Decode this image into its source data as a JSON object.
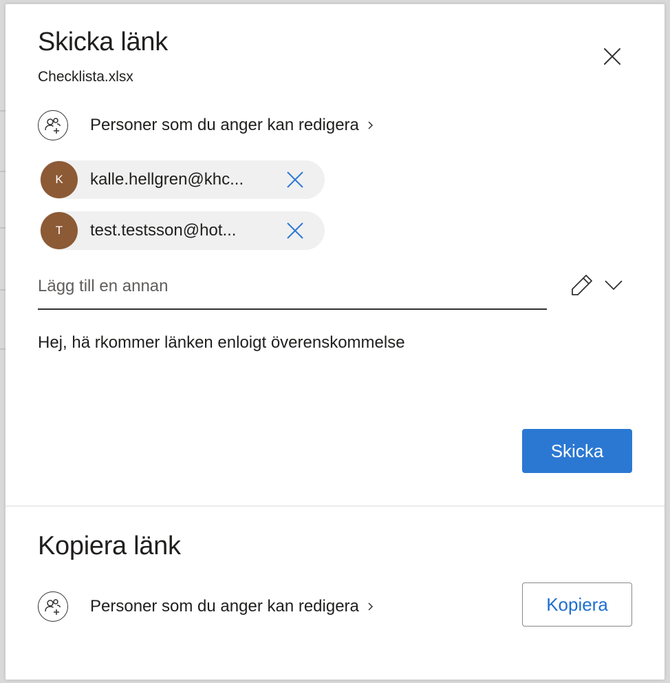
{
  "send_section": {
    "title": "Skicka länk",
    "filename": "Checklista.xlsx",
    "permission_label": "Personer som du anger kan redigera",
    "recipients": [
      {
        "initial": "K",
        "email": "kalle.hellgren@khc..."
      },
      {
        "initial": "T",
        "email": "test.testsson@hot..."
      }
    ],
    "add_placeholder": "Lägg till en annan",
    "message": "Hej, hä rkommer länken enloigt överenskommelse",
    "send_label": "Skicka"
  },
  "copy_section": {
    "title": "Kopiera länk",
    "permission_label": "Personer som du anger kan redigera",
    "copy_label": "Kopiera"
  },
  "colors": {
    "accent": "#2b78d3",
    "avatar": "#8c5a35",
    "chip_bg": "#f0f0f0",
    "remove_x": "#2b78d3"
  },
  "icons": [
    "close-icon",
    "people-add-icon",
    "chevron-right-icon",
    "remove-icon",
    "pencil-icon",
    "chevron-down-icon"
  ]
}
